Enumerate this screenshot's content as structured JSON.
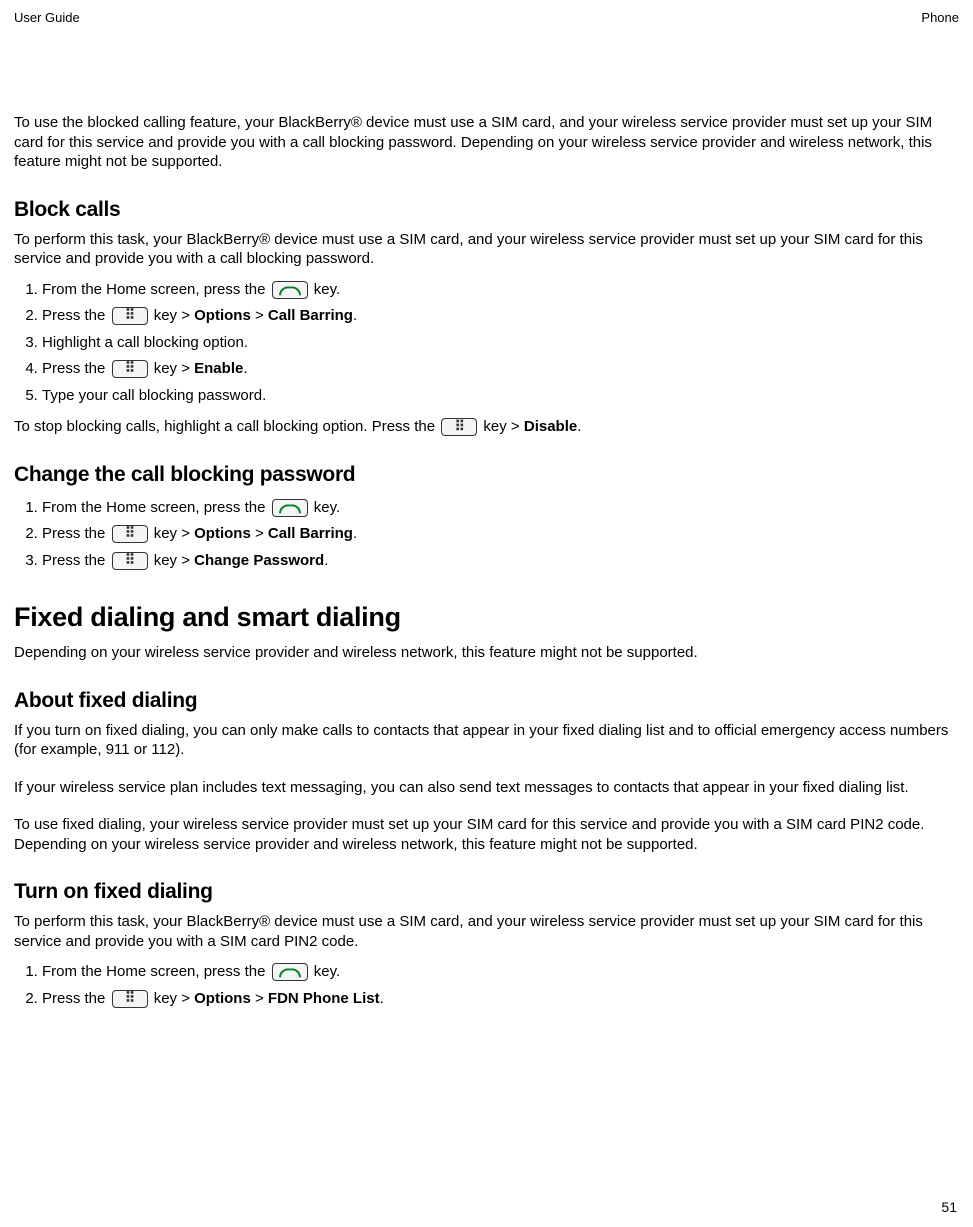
{
  "header": {
    "left": "User Guide",
    "right": "Phone"
  },
  "intro_para": "To use the blocked calling feature, your BlackBerry® device must use a SIM card, and your wireless service provider must set up your SIM card for this service and provide you with a call blocking password. Depending on your wireless service provider and wireless network, this feature might not be supported.",
  "block_calls": {
    "heading": "Block calls",
    "intro": "To perform this task, your BlackBerry® device must use a SIM card, and your wireless service provider must set up your SIM card for this service and provide you with a call blocking password.",
    "steps": {
      "s1a": "From the Home screen, press the ",
      "s1b": " key.",
      "s2a": "Press the ",
      "s2b": " key > ",
      "s2c": "Options",
      "s2d": " > ",
      "s2e": "Call Barring",
      "s2f": ".",
      "s3": "Highlight a call blocking option.",
      "s4a": "Press the ",
      "s4b": " key > ",
      "s4c": "Enable",
      "s4d": ".",
      "s5": "Type your call blocking password."
    },
    "outro_a": "To stop blocking calls, highlight a call blocking option. Press the ",
    "outro_b": " key > ",
    "outro_c": "Disable",
    "outro_d": "."
  },
  "change_pw": {
    "heading": "Change the call blocking password",
    "s1a": "From the Home screen, press the ",
    "s1b": " key.",
    "s2a": "Press the ",
    "s2b": " key > ",
    "s2c": "Options",
    "s2d": " > ",
    "s2e": "Call Barring",
    "s2f": ".",
    "s3a": "Press the ",
    "s3b": " key > ",
    "s3c": "Change Password",
    "s3d": "."
  },
  "fixed_dialing": {
    "heading": "Fixed dialing and smart dialing",
    "intro": "Depending on your wireless service provider and wireless network, this feature might not be supported."
  },
  "about_fixed": {
    "heading": "About fixed dialing",
    "p1": "If you turn on fixed dialing, you can only make calls to contacts that appear in your fixed dialing list and to official emergency access numbers (for example, 911 or 112).",
    "p2": "If your wireless service plan includes text messaging, you can also send text messages to contacts that appear in your fixed dialing list.",
    "p3": "To use fixed dialing, your wireless service provider must set up your SIM card for this service and provide you with a SIM card PIN2 code. Depending on your wireless service provider and wireless network, this feature might not be supported."
  },
  "turn_on_fixed": {
    "heading": "Turn on fixed dialing",
    "intro": "To perform this task, your BlackBerry® device must use a SIM card, and your wireless service provider must set up your SIM card for this service and provide you with a SIM card PIN2 code.",
    "s1a": "From the Home screen, press the ",
    "s1b": " key.",
    "s2a": "Press the ",
    "s2b": " key > ",
    "s2c": "Options",
    "s2d": " > ",
    "s2e": "FDN Phone List",
    "s2f": "."
  },
  "page_number": "51"
}
